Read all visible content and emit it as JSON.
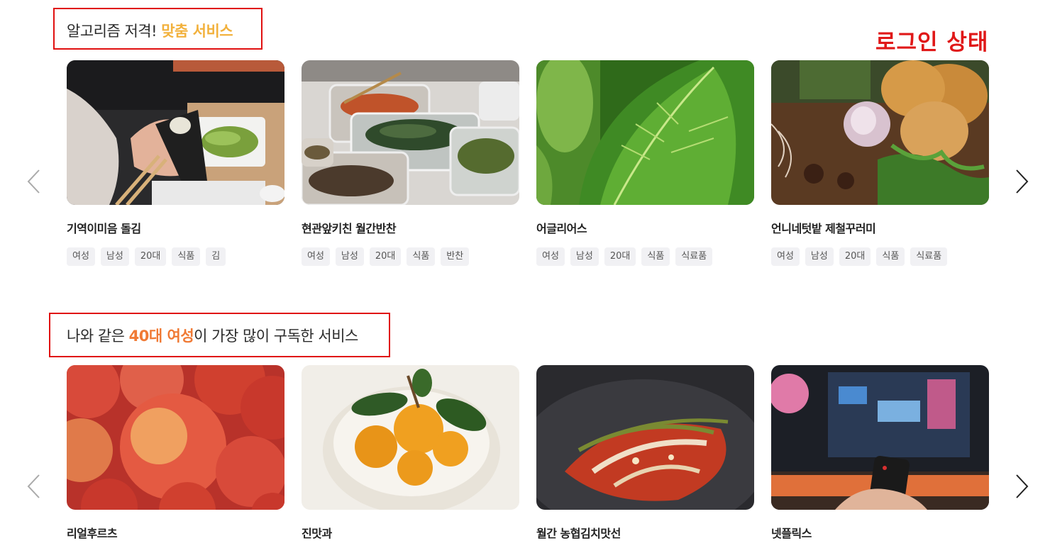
{
  "login_status": "로그인 상태",
  "sections": [
    {
      "title_plain": "알고리즘 저격! ",
      "title_highlight": "맞춤 서비스",
      "title_after": "",
      "highlight_color": "#f2b13c",
      "cards": [
        {
          "name": "기역이미음 돌김",
          "tags": [
            "여성",
            "남성",
            "20대",
            "식품",
            "김"
          ]
        },
        {
          "name": "현관앞키친 월간반찬",
          "tags": [
            "여성",
            "남성",
            "20대",
            "식품",
            "반찬"
          ]
        },
        {
          "name": "어글리어스",
          "tags": [
            "여성",
            "남성",
            "20대",
            "식품",
            "식료품"
          ]
        },
        {
          "name": "언니네텃밭 제철꾸러미",
          "tags": [
            "여성",
            "남성",
            "20대",
            "식품",
            "식료품"
          ]
        }
      ]
    },
    {
      "title_plain": "나와 같은 ",
      "title_highlight": "40대 여성",
      "title_after": "이 가장 많이 구독한 서비스",
      "highlight_color": "#f07a35",
      "cards": [
        {
          "name": "리얼후르츠",
          "tags": []
        },
        {
          "name": "진맛과",
          "tags": []
        },
        {
          "name": "월간 농협김치맛선",
          "tags": []
        },
        {
          "name": "넷플릭스",
          "tags": []
        }
      ]
    }
  ]
}
